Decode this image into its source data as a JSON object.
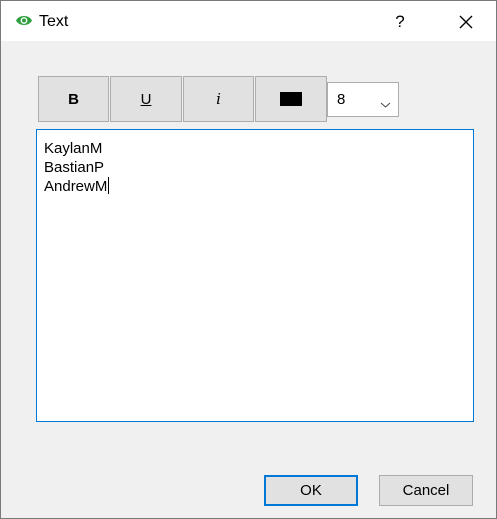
{
  "window": {
    "title": "Text",
    "help_label": "?",
    "app_icon": "eye-icon",
    "close_icon": "close-icon"
  },
  "toolbar": {
    "bold_label": "B",
    "underline_label": "U",
    "italic_label": "i",
    "color_swatch": "#000000",
    "font_size": "8",
    "dropdown_icon": "chevron-down-icon"
  },
  "editor": {
    "lines": [
      "KaylanM",
      "BastianP",
      "AndrewM"
    ]
  },
  "buttons": {
    "ok_label": "OK",
    "cancel_label": "Cancel"
  },
  "colors": {
    "accent": "#0078d7",
    "icon_green": "#2e9e3e",
    "button_face": "#e1e1e1",
    "dialog_bg": "#f0f0f0"
  }
}
